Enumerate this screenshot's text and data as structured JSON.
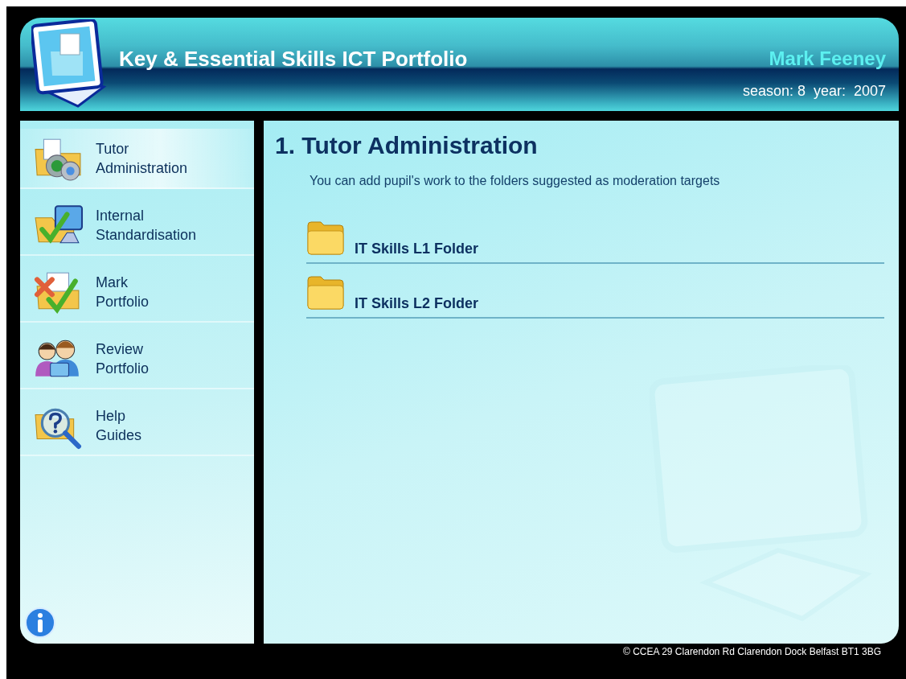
{
  "header": {
    "title": "Key & Essential Skills ICT Portfolio",
    "user_name": "Mark Feeney",
    "session": "season: 8  year:  2007"
  },
  "sidebar": {
    "items": [
      {
        "label": "Tutor Administration",
        "kind": "gears",
        "selected": true
      },
      {
        "label": "Internal Standardisation",
        "kind": "check-monitor",
        "selected": false
      },
      {
        "label": "Mark Portfolio",
        "kind": "mark",
        "selected": false
      },
      {
        "label": "Review Portfolio",
        "kind": "people",
        "selected": false
      },
      {
        "label": "Help Guides",
        "kind": "help",
        "selected": false
      }
    ]
  },
  "main": {
    "title": "1. Tutor Administration",
    "subtitle": "You can add pupil's work to the folders suggested as moderation targets",
    "folders": [
      {
        "label": "IT Skills L1 Folder"
      },
      {
        "label": "IT Skills L2 Folder"
      }
    ]
  },
  "footer": "© CCEA 29 Clarendon Rd Clarendon Dock Belfast BT1 3BG"
}
